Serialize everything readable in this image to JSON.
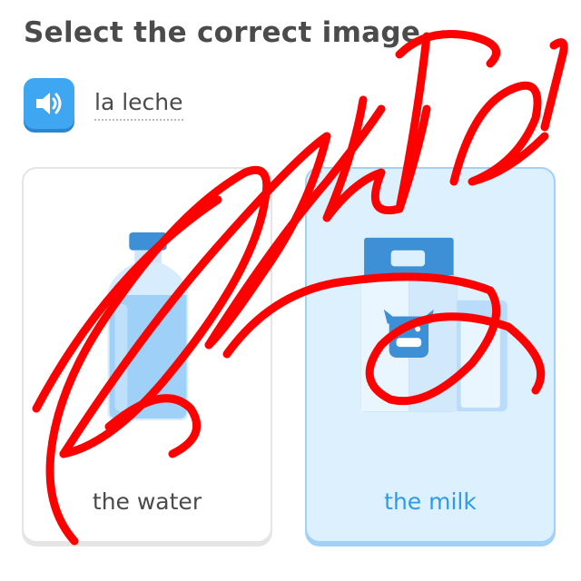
{
  "header": {
    "title": "Select the correct image"
  },
  "prompt": {
    "word": "la leche",
    "speaker_icon": "speaker-icon"
  },
  "choices": [
    {
      "label": "the water",
      "icon": "water-bottle-icon",
      "selected": false
    },
    {
      "label": "the milk",
      "icon": "milk-carton-icon",
      "selected": true
    }
  ],
  "overlay": {
    "handwriting": "Water",
    "color": "#ff0000"
  },
  "colors": {
    "accent": "#3fa6f1",
    "selected_card_bg": "#ddf0fd",
    "selected_text": "#2f9be8",
    "title_text": "#4b4b4b"
  }
}
